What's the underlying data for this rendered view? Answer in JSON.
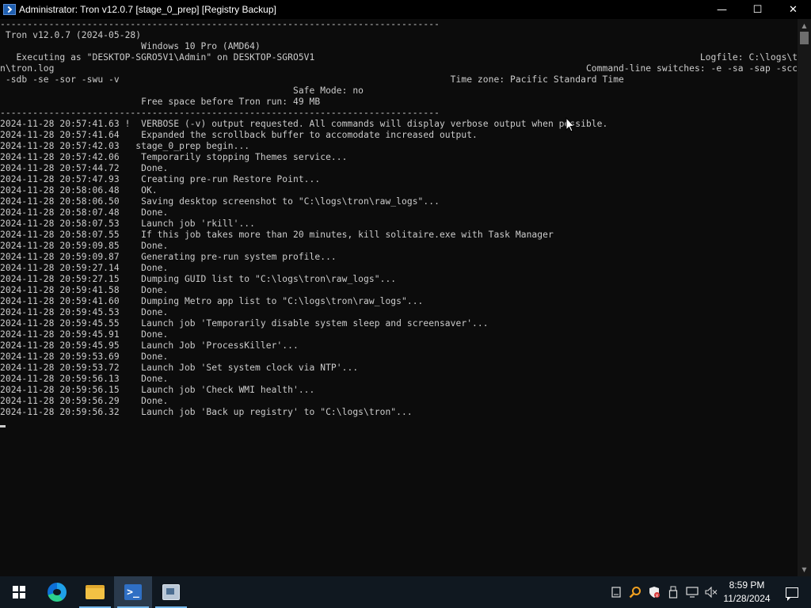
{
  "window": {
    "title": "Administrator:  Tron v12.0.7 [stage_0_prep] [Registry Backup]",
    "controls": {
      "minimize": "—",
      "maximize": "☐",
      "close": "✕"
    }
  },
  "console": {
    "lines": [
      "---------------------------------------------------------------------------------",
      " Tron v12.0.7 (2024-05-28)",
      "                          Windows 10 Pro (AMD64)",
      "   Executing as \"DESKTOP-SGRO5V1\\Admin\" on DESKTOP-SGRO5V1                                                                       Logfile: C:\\logs\\tro",
      "n\\tron.log                                                                                                  Command-line switches: -e -sa -sap -scc -sd",
      " -sdb -se -sor -swu -v                                                             Time zone: Pacific Standard Time",
      "                                                      Safe Mode: no",
      "                          Free space before Tron run: 49 MB",
      "---------------------------------------------------------------------------------",
      "2024-11-28 20:57:41.63 !  VERBOSE (-v) output requested. All commands will display verbose output when possible.",
      "2024-11-28 20:57:41.64    Expanded the scrollback buffer to accomodate increased output.",
      "2024-11-28 20:57:42.03   stage_0_prep begin...",
      "2024-11-28 20:57:42.06    Temporarily stopping Themes service...",
      "2024-11-28 20:57:44.72    Done.",
      "2024-11-28 20:57:47.93    Creating pre-run Restore Point...",
      "2024-11-28 20:58:06.48    OK.",
      "2024-11-28 20:58:06.50    Saving desktop screenshot to \"C:\\logs\\tron\\raw_logs\"...",
      "2024-11-28 20:58:07.48    Done.",
      "2024-11-28 20:58:07.53    Launch job 'rkill'...",
      "2024-11-28 20:58:07.55    If this job takes more than 20 minutes, kill solitaire.exe with Task Manager",
      "2024-11-28 20:59:09.85    Done.",
      "2024-11-28 20:59:09.87    Generating pre-run system profile...",
      "2024-11-28 20:59:27.14    Done.",
      "2024-11-28 20:59:27.15    Dumping GUID list to \"C:\\logs\\tron\\raw_logs\"...",
      "2024-11-28 20:59:41.58    Done.",
      "2024-11-28 20:59:41.60    Dumping Metro app list to \"C:\\logs\\tron\\raw_logs\"...",
      "2024-11-28 20:59:45.53    Done.",
      "2024-11-28 20:59:45.55    Launch job 'Temporarily disable system sleep and screensaver'...",
      "2024-11-28 20:59:45.91    Done.",
      "2024-11-28 20:59:45.95    Launch Job 'ProcessKiller'...",
      "2024-11-28 20:59:53.69    Done.",
      "2024-11-28 20:59:53.72    Launch Job 'Set system clock via NTP'...",
      "2024-11-28 20:59:56.13    Done.",
      "2024-11-28 20:59:56.15    Launch job 'Check WMI health'...",
      "2024-11-28 20:59:56.29    Done.",
      "2024-11-28 20:59:56.32    Launch job 'Back up registry' to \"C:\\logs\\tron\"..."
    ]
  },
  "scrollbar": {
    "up_arrow": "▲",
    "down_arrow": "▼"
  },
  "taskbar": {
    "apps": [
      {
        "name": "start",
        "icon": "windows-logo-icon"
      },
      {
        "name": "edge",
        "icon": "edge-icon"
      },
      {
        "name": "file-explorer",
        "icon": "folder-icon"
      },
      {
        "name": "powershell",
        "icon": "powershell-icon",
        "glyph": ">_"
      },
      {
        "name": "tool",
        "icon": "app-window-icon"
      }
    ],
    "tray": {
      "icons": [
        "keyboard-icon",
        "search-tool-icon",
        "defender-shield-icon",
        "usb-icon",
        "network-icon",
        "volume-muted-icon"
      ],
      "time": "8:59 PM",
      "date": "11/28/2024"
    }
  },
  "colors": {
    "console_bg": "#0c0c0c",
    "console_fg": "#cccccc",
    "taskbar_bg": "#101820",
    "accent": "#76b9ed"
  }
}
